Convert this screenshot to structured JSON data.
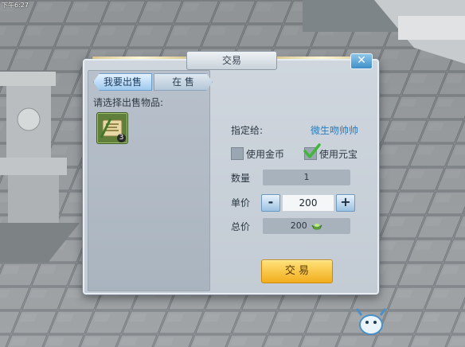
{
  "status_bar": {
    "time": "下午6:27"
  },
  "dialog": {
    "title": "交易",
    "close_icon": "close-icon",
    "tabs": [
      {
        "label": "我要出售",
        "selected": true
      },
      {
        "label": "在 售",
        "selected": false
      }
    ],
    "prompt": "请选择出售物品:",
    "item": {
      "icon": "scroll-icon",
      "count": "3"
    },
    "target_label": "指定给:",
    "target_name": "微生吻帅帅",
    "currency_options": [
      {
        "label": "使用金币",
        "checked": false
      },
      {
        "label": "使用元宝",
        "checked": true
      }
    ],
    "quantity": {
      "label": "数量",
      "value": "1"
    },
    "unit_price": {
      "label": "单价",
      "minus": "-",
      "value": "200",
      "plus": "+"
    },
    "total": {
      "label": "总价",
      "value": "200",
      "currency_icon": "ingot-icon"
    },
    "trade_button": "交 易"
  },
  "colors": {
    "accent_blue": "#2a7cc0",
    "button_gold": "#f2ad1d"
  }
}
